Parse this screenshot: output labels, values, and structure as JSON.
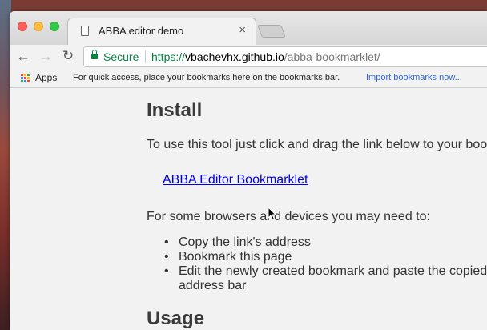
{
  "browser": {
    "tab": {
      "title": "ABBA editor demo",
      "close_glyph": "×",
      "icon": "document-icon"
    },
    "toolbar": {
      "back_glyph": "←",
      "forward_glyph": "→",
      "reload_glyph": "↻"
    },
    "address_bar": {
      "security_label": "Secure",
      "url_scheme": "https://",
      "url_host": "vbachevhx.github.io",
      "url_path": "/abba-bookmarklet/"
    },
    "bookmarks_bar": {
      "apps_label": "Apps",
      "message": "For quick access, place your bookmarks here on the bookmarks bar.",
      "import_link": "Import bookmarks now..."
    }
  },
  "page": {
    "install_heading": "Install",
    "intro_text": "To use this tool just click and drag the link below to your boo",
    "bookmarklet_link": "ABBA Editor Bookmarklet",
    "need_text": "For some browsers and devices you may need to:",
    "steps": [
      "Copy the link's address",
      "Bookmark this page",
      "Edit the newly created bookmark and paste the copied",
      "address bar"
    ],
    "usage_heading": "Usage"
  },
  "colors": {
    "secure_green": "#0b8043",
    "link_blue": "#0000ee",
    "import_link_blue": "#3367d6"
  }
}
